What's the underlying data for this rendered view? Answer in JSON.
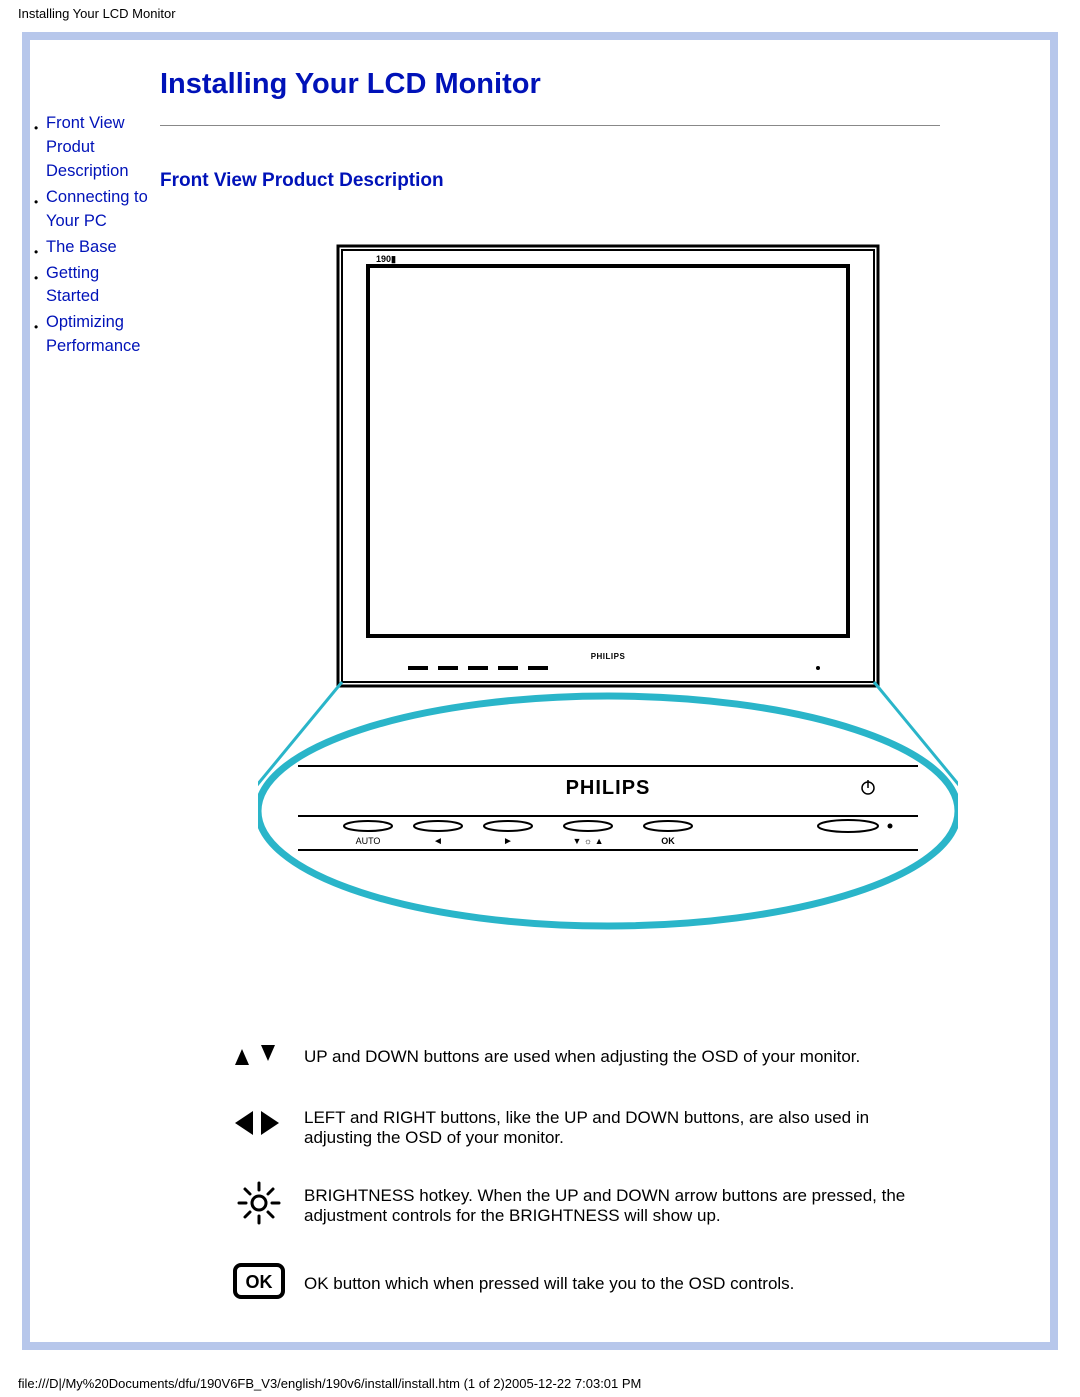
{
  "header": {
    "title": "Installing Your LCD Monitor"
  },
  "sidebar": {
    "items": [
      {
        "label": "Front View Produt Description"
      },
      {
        "label": "Connecting to Your PC"
      },
      {
        "label": "The Base"
      },
      {
        "label": "Getting Started"
      },
      {
        "label": "Optimizing Performance"
      }
    ]
  },
  "main": {
    "h1": "Installing Your LCD Monitor",
    "h2": "Front View Product Description",
    "figure": {
      "brand": "PHILIPS",
      "model": "190",
      "bezel_labels": [
        "AUTO",
        "◄",
        "►",
        "▼ ☼ ▲",
        "OK"
      ]
    },
    "rows": [
      {
        "icon": "up-down",
        "text": "UP and DOWN buttons are used when adjusting the OSD of your monitor."
      },
      {
        "icon": "left-right",
        "text": "LEFT and RIGHT buttons, like the UP and DOWN buttons, are also used in adjusting the OSD of your monitor."
      },
      {
        "icon": "brightness",
        "text": "BRIGHTNESS hotkey. When the UP and DOWN arrow buttons are pressed, the adjustment controls for the BRIGHTNESS will show up."
      },
      {
        "icon": "ok",
        "text": "OK button which when pressed will take you to the OSD controls."
      }
    ]
  },
  "footer": {
    "path": "file:///D|/My%20Documents/dfu/190V6FB_V3/english/190v6/install/install.htm (1 of 2)2005-12-22 7:03:01 PM"
  }
}
